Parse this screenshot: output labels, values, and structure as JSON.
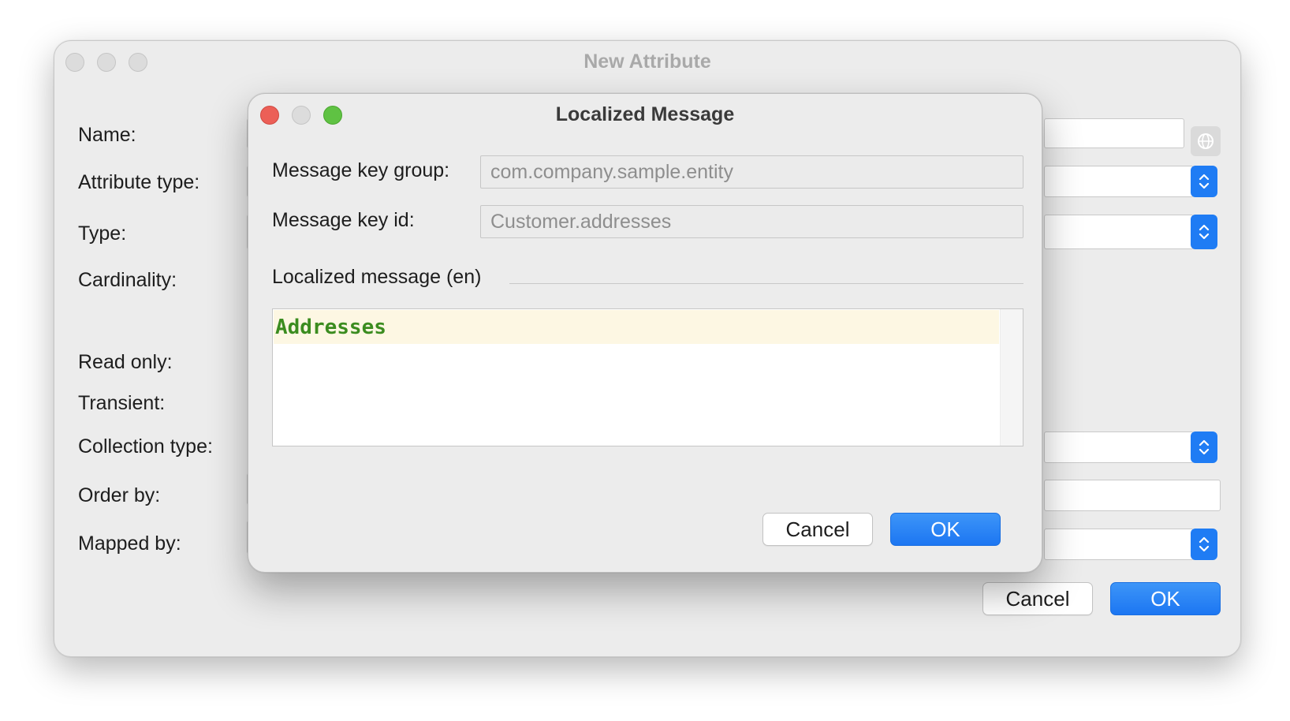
{
  "parent_window": {
    "title": "New Attribute",
    "labels": {
      "name": "Name:",
      "attribute_type": "Attribute type:",
      "type": "Type:",
      "cardinality": "Cardinality:",
      "read_only": "Read only:",
      "transient": "Transient:",
      "collection_type": "Collection type:",
      "order_by": "Order by:",
      "mapped_by": "Mapped by:"
    },
    "cancel_label": "Cancel",
    "ok_label": "OK"
  },
  "dialog": {
    "title": "Localized Message",
    "message_key_group": {
      "label": "Message key group:",
      "value": "com.company.sample.entity"
    },
    "message_key_id": {
      "label": "Message key id:",
      "value": "Customer.addresses"
    },
    "section_label": "Localized message (en)",
    "message_text": "Addresses",
    "cancel_label": "Cancel",
    "ok_label": "OK"
  },
  "colors": {
    "accent": "#1f7cf4",
    "message_text": "#3b8c1f",
    "current_line": "#fdf7e3"
  },
  "icons": [
    "globe-icon",
    "stepper-icon",
    "close-icon",
    "minimize-icon",
    "zoom-icon"
  ]
}
